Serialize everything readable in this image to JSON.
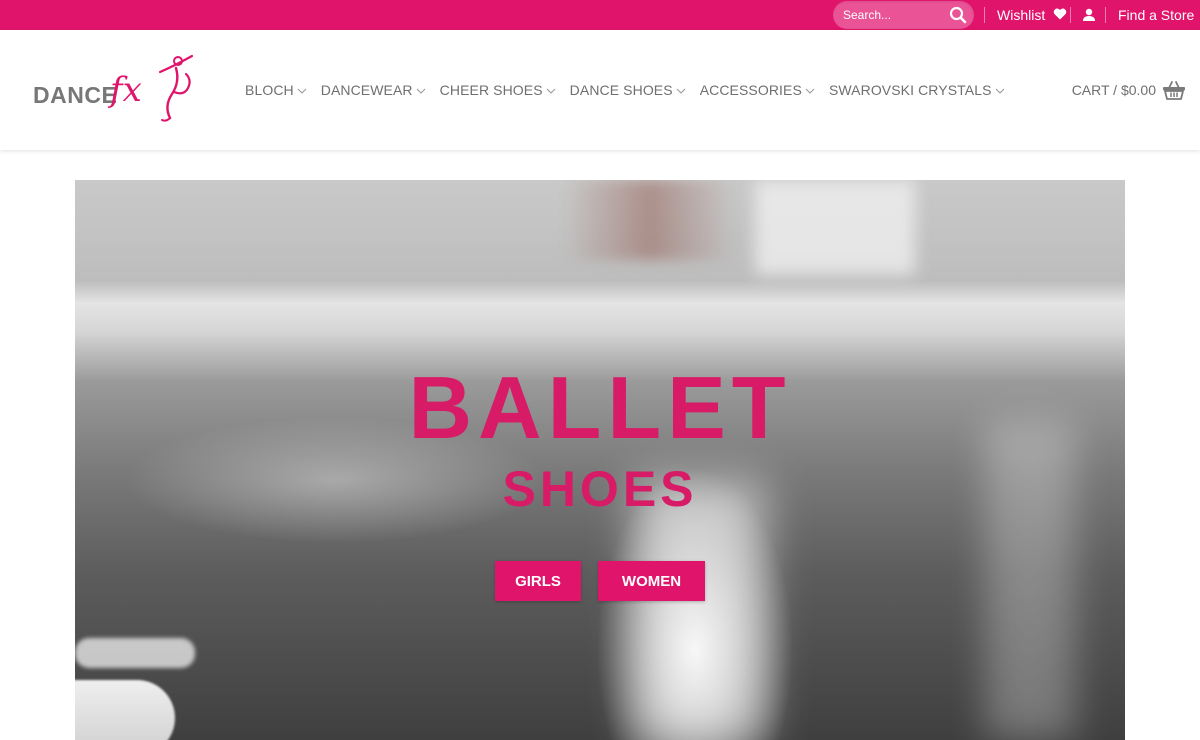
{
  "colors": {
    "brand_pink": "#e0146b",
    "nav_text": "#6f6f6f",
    "white": "#ffffff"
  },
  "topbar": {
    "search": {
      "placeholder": "Search...",
      "icon": "search-icon"
    },
    "wishlist_label": "Wishlist",
    "wishlist_icon": "heart-icon",
    "account_icon": "user-icon",
    "find_store_label": "Find a Store"
  },
  "header": {
    "logo": {
      "word": "DANCE",
      "script": "fx"
    },
    "nav": [
      {
        "label": "BLOCH",
        "icon": "chevron-down-icon"
      },
      {
        "label": "DANCEWEAR",
        "icon": "chevron-down-icon"
      },
      {
        "label": "CHEER SHOES",
        "icon": "chevron-down-icon"
      },
      {
        "label": "DANCE SHOES",
        "icon": "chevron-down-icon"
      },
      {
        "label": "ACCESSORIES",
        "icon": "chevron-down-icon"
      },
      {
        "label": "SWAROVSKI CRYSTALS",
        "icon": "chevron-down-icon"
      }
    ],
    "cart": {
      "label": "CART / $0.00",
      "icon": "basket-icon"
    }
  },
  "hero": {
    "title": "BALLET",
    "subtitle": "SHOES",
    "buttons": [
      {
        "label": "GIRLS"
      },
      {
        "label": "WOMEN"
      }
    ]
  }
}
